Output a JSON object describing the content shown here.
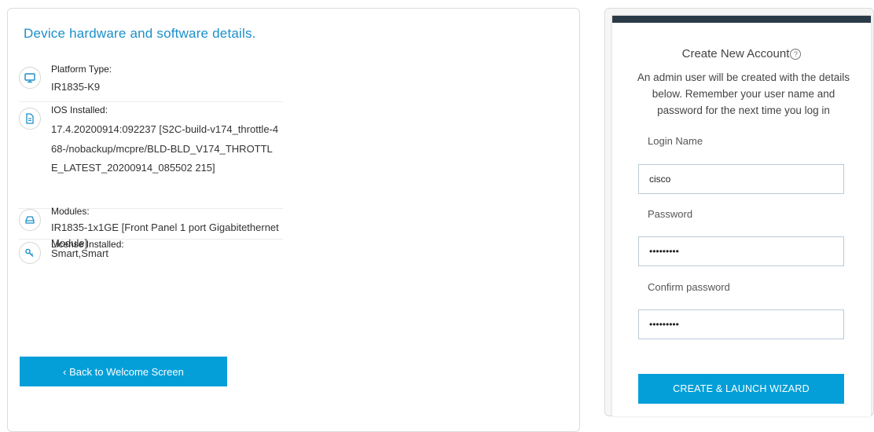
{
  "details": {
    "title": "Device hardware and software details.",
    "platform": {
      "label": "Platform Type:",
      "value": "IR1835-K9"
    },
    "ios": {
      "label": "IOS Installed:",
      "value": "17.4.20200914:092237 [S2C-build-v174_throttle-468-/nobackup/mcpre/BLD-BLD_V174_THROTTLE_LATEST_20200914_085502 215]"
    },
    "modules": {
      "label": "Modules:",
      "value": "IR1835-1x1GE [Front Panel 1 port Gigabitethernet Module]"
    },
    "license": {
      "label": "License Installed:",
      "value": "Smart,Smart"
    },
    "back_label": "‹ Back to Welcome Screen"
  },
  "account": {
    "title": "Create New Account",
    "description": "An admin user will be created with the details below. Remember your user name and password for the next time you log in",
    "login_label": "Login Name",
    "login_value": "cisco",
    "password_label": "Password",
    "password_value": "cisco1234",
    "confirm_label": "Confirm password",
    "confirm_value": "cisco1234",
    "create_label": "CREATE & LAUNCH WIZARD"
  },
  "colors": {
    "accent": "#049fd9",
    "title": "#1b8fc9",
    "card_bar": "#2b3a47"
  },
  "icons": [
    "monitor-icon",
    "document-icon",
    "drive-icon",
    "key-icon",
    "help-icon"
  ]
}
